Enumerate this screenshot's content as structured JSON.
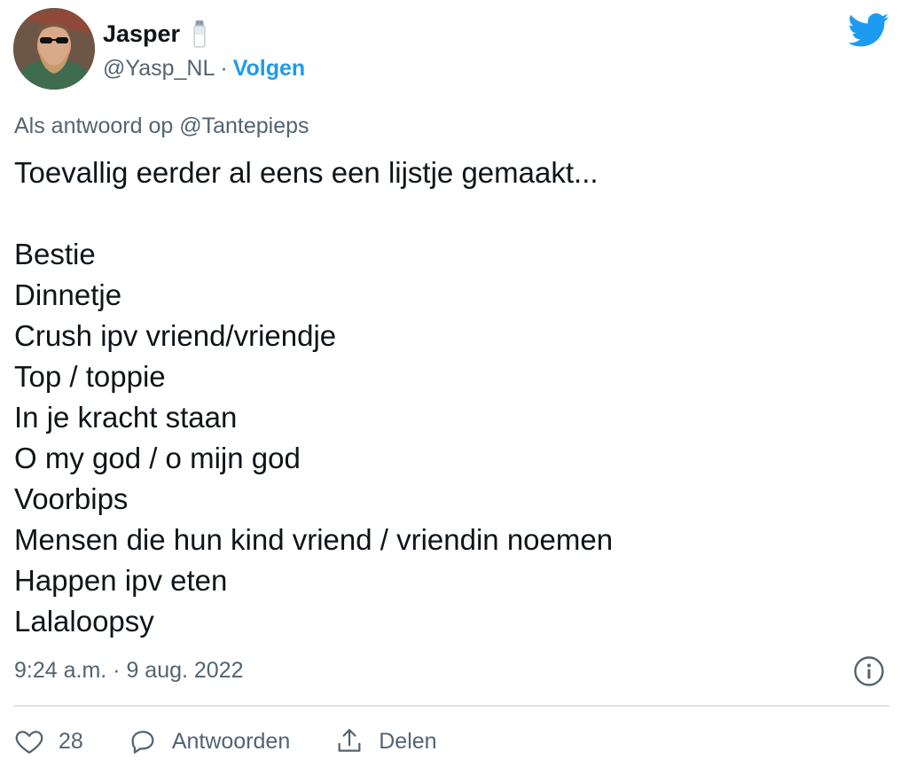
{
  "author": {
    "display_name": "Jasper",
    "handle": "@Yasp_NL",
    "separator": "·",
    "follow_label": "Volgen"
  },
  "reply_context": {
    "prefix": "Als antwoord op",
    "mention": "@Tantepieps"
  },
  "tweet": {
    "lines": [
      "Toevallig eerder al eens een lijstje gemaakt...",
      "",
      "Bestie",
      "Dinnetje",
      "Crush ipv vriend/vriendje",
      "Top / toppie",
      "In je kracht staan",
      "O my god / o mijn god",
      "Voorbips",
      "Mensen die hun kind vriend / vriendin noemen",
      "Happen ipv eten",
      "Lalaloopsy"
    ]
  },
  "timestamp": "9:24 a.m. · 9 aug. 2022",
  "actions": {
    "like_count": "28",
    "reply_label": "Antwoorden",
    "share_label": "Delen"
  },
  "icons": {
    "brand": "twitter-bird-icon",
    "badge": "salt-shaker-icon",
    "info": "info-icon",
    "like": "heart-icon",
    "reply": "speech-bubble-icon",
    "share": "share-icon"
  },
  "colors": {
    "accent": "#1d9bf0",
    "text_primary": "#0f1419",
    "text_secondary": "#536471",
    "divider": "#dde3e8"
  }
}
